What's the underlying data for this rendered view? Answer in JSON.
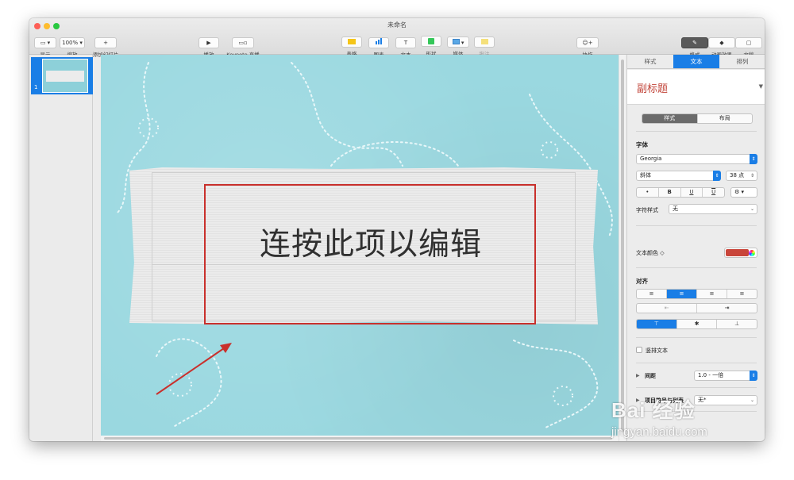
{
  "window": {
    "title": "未命名",
    "colors": {
      "close": "#fd5f57",
      "minimize": "#febc2e",
      "zoom": "#28c840",
      "accent": "#1a7ee6",
      "slide_bg": "#9ad8e0",
      "highlight": "#c9302c"
    }
  },
  "toolbar": {
    "view": {
      "label": "显示",
      "icon": "sidebar-icon"
    },
    "zoom": {
      "label": "缩放",
      "value": "100%"
    },
    "add_slide": {
      "label": "添加幻灯片",
      "glyph": "+"
    },
    "play": {
      "label": "播放",
      "glyph": "▶"
    },
    "keynote_live": {
      "label": "Keynote 直播"
    },
    "table": {
      "label": "表格",
      "color": "#f5c518"
    },
    "chart": {
      "label": "图表",
      "color": "#1a7ee6"
    },
    "text": {
      "label": "文本",
      "glyph": "T"
    },
    "shape": {
      "label": "形状",
      "color": "#34c759"
    },
    "media": {
      "label": "媒体"
    },
    "comment": {
      "label": "批注",
      "color": "#f5e07a"
    },
    "collaborate": {
      "label": "协作"
    },
    "format": {
      "label": "格式"
    },
    "animate": {
      "label": "动画效果"
    },
    "document": {
      "label": "文稿"
    }
  },
  "navigator": {
    "slide_number": "1"
  },
  "slide": {
    "placeholder": "连按此项以编辑"
  },
  "inspector": {
    "tabs": [
      "样式",
      "文本",
      "排列"
    ],
    "paragraph_style": "副标题",
    "subtabs": [
      "样式",
      "布局"
    ],
    "font_header": "字体",
    "font_family": "Georgia",
    "font_typeface": "斜体",
    "font_size": "38 点",
    "style_buttons": [
      "•",
      "B",
      "U",
      "U"
    ],
    "char_style_label": "字符样式",
    "char_style_value": "无",
    "text_color_label": "文本颜色 ◇",
    "text_color": "#c9453a",
    "align_header": "对齐",
    "align_h": [
      "≡",
      "≡",
      "≡",
      "≡"
    ],
    "indent": [
      "⇤",
      "⇥"
    ],
    "align_v": [
      "⊤",
      "✱",
      "⊥"
    ],
    "vertical_text": "竖排文本",
    "spacing_label": "间距",
    "spacing_value": "1.0 - 一倍",
    "bullets_label": "项目符号与列表",
    "bullets_value": "无*"
  },
  "watermark": {
    "brand": "Bai 经验",
    "url": "jingyan.baidu.com"
  }
}
